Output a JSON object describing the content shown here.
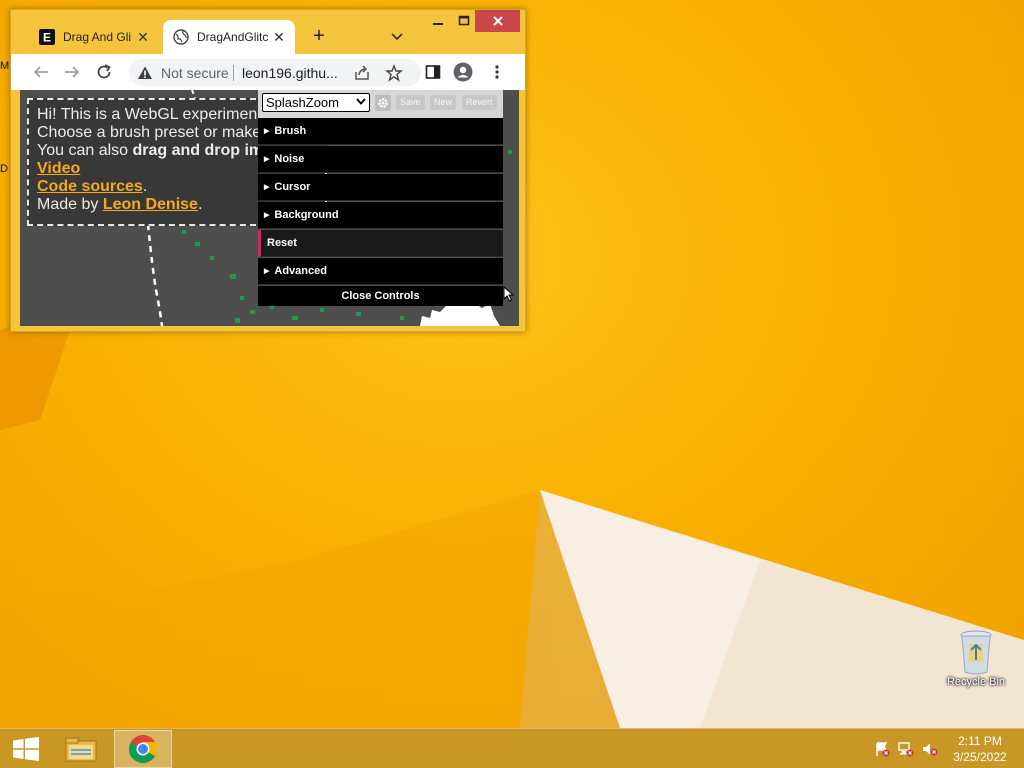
{
  "desktop": {
    "edge_labels": [
      "M",
      "D"
    ],
    "recycle_bin_label": "Recycle Bin"
  },
  "browser": {
    "tabs": [
      {
        "title": "Drag And Gli",
        "favicon": "e-logo-icon",
        "active": false
      },
      {
        "title": "DragAndGlitc",
        "favicon": "globe-icon",
        "active": true
      }
    ],
    "tab_close_glyph": "✕",
    "new_tab_glyph": "+",
    "address": {
      "security_label": "Not secure",
      "url": "leon196.githu..."
    }
  },
  "page": {
    "intro": {
      "line1": "Hi! This is a WebGL experimen",
      "line2": "Choose a brush preset or make",
      "line3_prefix": "You can also ",
      "line3_bold": "drag and drop im",
      "video_link": "Video",
      "code_link": "Code sources",
      "code_suffix": ".",
      "made_by_prefix": "Made by ",
      "author_link": "Leon Denise",
      "author_suffix": "."
    },
    "controls": {
      "preset_selected": "SplashZoom",
      "save_label": "Save",
      "new_label": "New",
      "revert_label": "Revert",
      "folders": [
        "Brush",
        "Noise",
        "Cursor",
        "Background",
        "Reset",
        "Advanced"
      ],
      "close_label": "Close Controls",
      "accent_color": "#e61d5f"
    }
  },
  "taskbar": {
    "time": "2:11 PM",
    "date": "3/25/2022"
  }
}
